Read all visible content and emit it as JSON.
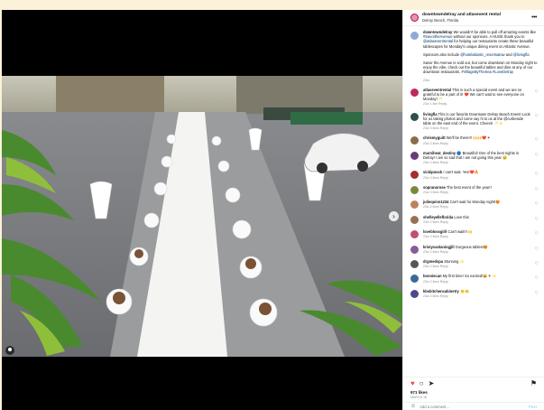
{
  "post": {
    "header": {
      "username": "downtowndelray and atlasevent rental",
      "location": "Delray Beach, Florida",
      "more_icon": "more-dots-icon"
    },
    "caption": {
      "username": "downtowndelray",
      "p1_text": "We wouldn't be able to pull off amazing events like ",
      "p1_tag1": "#SavortheAvenue",
      "p1_text2": " without our sponsors. A HUGE thank you to ",
      "p1_tag2": "@atlaseventrental",
      "p1_text3": " for helping our restaurants create these beautiful tablescapes for Monday's unique dining event on Atlantic Avenue.",
      "p2_text": "Sponsors also include ",
      "p2_tag1": "@hotelatlantic_resortsatow",
      "p2_text2": " and ",
      "p2_tag2": "@livingfla",
      "p3_text": "Savor the Avenue is sold out, but come downtown on Monday night to enjoy the vibe, check out the beautiful tables and dine at any of our downtown restaurants. ",
      "p3_tag1": "#VillageByTheSea",
      "p3_tag2": "#LoveDelray",
      "time": "23w"
    },
    "comments": [
      {
        "username": "atlaseventrental",
        "text": "This is such a special event and we are so grateful to be a part of it! ❤️ We can't wait to see everyone on Monday! 🥂",
        "time": "23w",
        "likes": "1 like",
        "reply": "Reply",
        "avatar_color": "#c0285e"
      },
      {
        "username": "livingfla",
        "text": "This is our favorite Downtown Delray Beach Event! Look for us taking photos and come say hi to us at the @curbeside table on the east end of the event. Cheers! 🥂✨",
        "time": "23w",
        "likes": "3 likes",
        "reply": "Reply",
        "avatar_color": "#2f4f4f"
      },
      {
        "username": "chrismyguitt",
        "text": "We'll be there!!! 🙌🙌❤️🍷",
        "time": "23w",
        "likes": "2 likes",
        "reply": "Reply",
        "avatar_color": "#8b6b4a"
      },
      {
        "username": "marniheat_destiny",
        "text": "🔵 Beautiful! One of the best nights in Delray! I am so sad that I am not going this year 😢",
        "time": "23w",
        "likes": "2 likes",
        "reply": "Reply",
        "avatar_color": "#6a3d7a"
      },
      {
        "username": "vickipoock",
        "text": "I can't wait. Yes!❤️🔥",
        "time": "23w",
        "likes": "3 likes",
        "reply": "Reply",
        "avatar_color": "#a03030"
      },
      {
        "username": "sopranorose",
        "text": "The best event of the year!!",
        "time": "23w",
        "likes": "3 likes",
        "reply": "Reply",
        "avatar_color": "#7a8a3a"
      },
      {
        "username": "juliequinn1234",
        "text": "Can't wait for Monday night!😍",
        "time": "23w",
        "likes": "2 likes",
        "reply": "Reply",
        "avatar_color": "#c08060"
      },
      {
        "username": "shelleyelleflorida",
        "text": "Love this",
        "time": "23w",
        "likes": "2 likes",
        "reply": "Reply",
        "avatar_color": "#9a7050"
      },
      {
        "username": "loveblossgirll",
        "text": "Can't wait!!! 🙌",
        "time": "23w",
        "likes": "2 likes",
        "reply": "Reply",
        "avatar_color": "#c05070"
      },
      {
        "username": "kristyvanlaningjill",
        "text": "Gorgeous tables!😍",
        "time": "23w",
        "likes": "2 likes",
        "reply": "Reply",
        "avatar_color": "#8a5a9a"
      },
      {
        "username": "drgmedspa",
        "text": "Stunning ✨",
        "time": "23w",
        "likes": "2 likes",
        "reply": "Reply",
        "avatar_color": "#555555"
      },
      {
        "username": "bonniecan",
        "text": "My first time! So excited!😆🍷✨",
        "time": "23w",
        "likes": "2 likes",
        "reply": "Reply",
        "avatar_color": "#3a6a9a"
      },
      {
        "username": "kbsbitchencabinetry",
        "text": "👏👏",
        "time": "23w",
        "likes": "2 likes",
        "reply": "Reply",
        "avatar_color": "#4a4a8a"
      }
    ],
    "actions": {
      "like_icon": "heart-filled-icon",
      "comment_icon": "comment-icon",
      "share_icon": "paper-plane-icon",
      "save_icon": "bookmark-icon",
      "likes": "971 likes",
      "date": "MARCH 16"
    },
    "add_comment": {
      "placeholder": "Add a comment...",
      "post_label": "Post"
    }
  }
}
